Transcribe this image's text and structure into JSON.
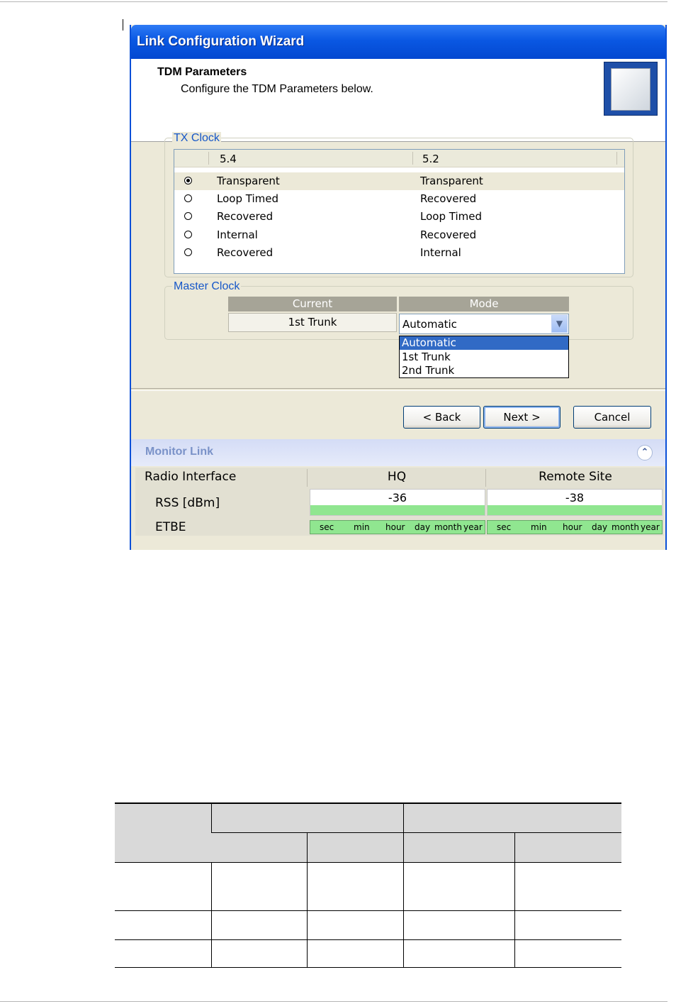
{
  "window": {
    "title": "Link Configuration Wizard",
    "header_title": "TDM Parameters",
    "header_subtitle": "Configure the TDM Parameters below."
  },
  "tx_clock": {
    "legend": "TX Clock",
    "col1": "5.4",
    "col2": "5.2",
    "rows": [
      {
        "site1": "Transparent",
        "site2": "Transparent",
        "selected": true
      },
      {
        "site1": "Loop Timed",
        "site2": "Recovered",
        "selected": false
      },
      {
        "site1": "Recovered",
        "site2": "Loop Timed",
        "selected": false
      },
      {
        "site1": "Internal",
        "site2": "Recovered",
        "selected": false
      },
      {
        "site1": "Recovered",
        "site2": "Internal",
        "selected": false
      }
    ]
  },
  "master_clock": {
    "legend": "Master Clock",
    "head_current": "Current",
    "head_mode": "Mode",
    "current_value": "1st Trunk",
    "mode_value": "Automatic",
    "options": [
      "Automatic",
      "1st Trunk",
      "2nd Trunk"
    ]
  },
  "buttons": {
    "back": "< Back",
    "next": "Next >",
    "cancel": "Cancel"
  },
  "monitor": {
    "title": "Monitor Link",
    "col_label": "Radio Interface",
    "col_site1": "HQ",
    "col_site2": "Remote Site",
    "rss_label": "RSS [dBm]",
    "rss_site1": "-36",
    "rss_site2": "-38",
    "etbe_label": "ETBE",
    "etbe_scale": [
      "sec",
      "min",
      "hour",
      "day",
      "month",
      "year"
    ]
  }
}
